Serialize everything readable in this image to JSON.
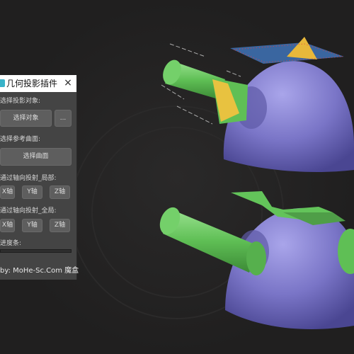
{
  "window": {
    "title": "几何投影插件",
    "close_icon": "×"
  },
  "sections": {
    "projection_object": {
      "label": "选择投影对象:",
      "select_button": "选择对象",
      "more_button": "..."
    },
    "reference_surface": {
      "label": "选择参考曲面:",
      "select_button": "选择曲面"
    },
    "local_projection": {
      "label": "通过轴向投射_局部:",
      "buttons": [
        "X轴",
        "Y轴",
        "Z轴"
      ]
    },
    "global_projection": {
      "label": "通过轴向投射_全局:",
      "buttons": [
        "X轴",
        "Y轴",
        "Z轴"
      ]
    },
    "progress": {
      "label": "进度条:",
      "value": 0
    }
  },
  "footer": {
    "text": "by: MoHe-Sc.Com 魔盒"
  },
  "colors": {
    "background": "#201f1f",
    "panel": "#444444",
    "button": "#5e5e5e",
    "title_bar": "#ffffff",
    "teapot_body": "#7b76c6",
    "teapot_parts": "#63c45a"
  }
}
